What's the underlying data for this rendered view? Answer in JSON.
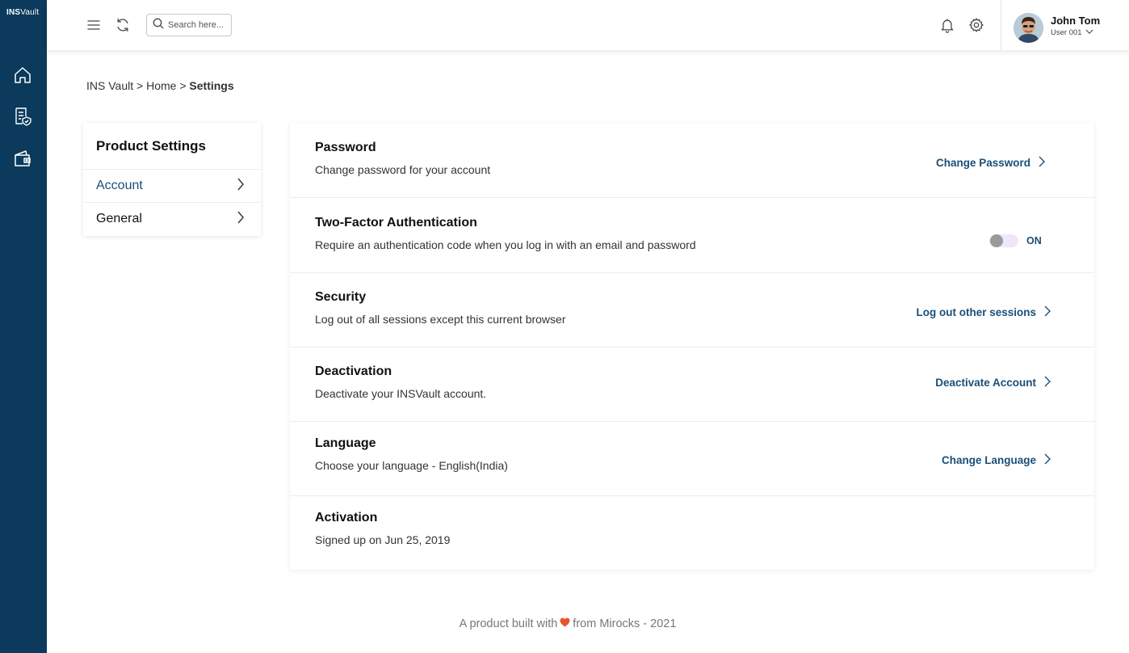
{
  "app": {
    "logo_bold": "INS",
    "logo_rest": "Vault"
  },
  "sidebar": {
    "items": [
      {
        "icon": "home-icon"
      },
      {
        "icon": "document-shield-icon"
      },
      {
        "icon": "wallet-icon"
      }
    ]
  },
  "topbar": {
    "search_placeholder": "Search here...",
    "user_name": "John Tom",
    "user_role": "User 001"
  },
  "breadcrumb": {
    "part1": "INS Vault",
    "sep1": " > ",
    "part2": "Home",
    "sep2": " > ",
    "current": "Settings"
  },
  "left_panel": {
    "title": "Product Settings",
    "items": [
      {
        "label": "Account",
        "active": true
      },
      {
        "label": "General",
        "active": false
      }
    ]
  },
  "settings": {
    "rows": [
      {
        "title": "Password",
        "desc": "Change password for your account",
        "action": "Change Password"
      },
      {
        "title": "Two-Factor Authentication",
        "desc": "Require an authentication code when you log in with an email and password",
        "toggle_label": "ON"
      },
      {
        "title": "Security",
        "desc": "Log out of all sessions except this current browser",
        "action": "Log out other sessions"
      },
      {
        "title": "Deactivation",
        "desc": "Deactivate your INSVault account.",
        "action": "Deactivate Account"
      },
      {
        "title": "Language",
        "desc": "Choose your language - English(India)",
        "action": "Change Language"
      },
      {
        "title": "Activation",
        "desc": "Signed up on Jun 25, 2019"
      }
    ]
  },
  "footer": {
    "before": "A product built with",
    "after": "from Mirocks - 2021"
  },
  "colors": {
    "sidebar": "#0b3a5c",
    "accent": "#1a4f78",
    "heart": "#e8552b"
  }
}
